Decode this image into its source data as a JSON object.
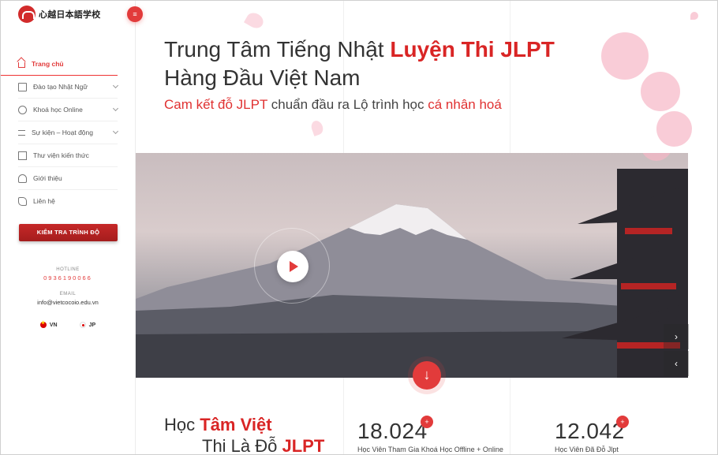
{
  "sidebar": {
    "brand": "心越日本語学校",
    "menu_icon": "hamburger-icon",
    "nav": [
      {
        "label": "Trang chủ",
        "icon": "home-icon"
      },
      {
        "label": "Đào tạo Nhật Ngữ",
        "icon": "book-icon"
      },
      {
        "label": "Khoá học Online",
        "icon": "chat-icon"
      },
      {
        "label": "Sự kiện – Hoạt động",
        "icon": "event-icon"
      },
      {
        "label": "Thư viện kiến thức",
        "icon": "library-icon"
      },
      {
        "label": "Giới thiệu",
        "icon": "user-icon"
      },
      {
        "label": "Liên hệ",
        "icon": "phone-icon"
      }
    ],
    "cta": "KIỂM TRA TRÌNH ĐỘ",
    "hotline_label": "HOTLINE",
    "hotline_value": "0936190066",
    "email_label": "EMAIL",
    "email_value": "info@vietcocoio.edu.vn",
    "languages": [
      "VN",
      "JP"
    ]
  },
  "hero": {
    "headline_prefix": "Trung Tâm Tiếng Nhật ",
    "headline_highlight": "Luyện Thi JLPT",
    "headline_line2": "Hàng Đầu Việt Nam",
    "sub_red1": "Cam kết đỗ JLPT",
    "sub_mid": " chuẩn đầu ra Lộ trình học ",
    "sub_red2": "cá nhân hoá",
    "next_arrow": "›",
    "prev_arrow": "‹",
    "scroll_down": "↓"
  },
  "stats": {
    "title_a": "Học ",
    "title_a_hl": "Tâm Việt",
    "title_b": "Thi Là Đỗ ",
    "title_b_hl": "JLPT",
    "items": [
      {
        "value": "18.024",
        "label": "Học Viên Tham Gia Khoá Học Offline + Online"
      },
      {
        "value": "12.042",
        "label": "Học Viên Đã Đỗ Jlpt"
      }
    ],
    "plus": "+"
  },
  "colors": {
    "accent": "#e23b3b",
    "dark_red": "#a51d1d",
    "blossom": "#f7b6c6"
  }
}
